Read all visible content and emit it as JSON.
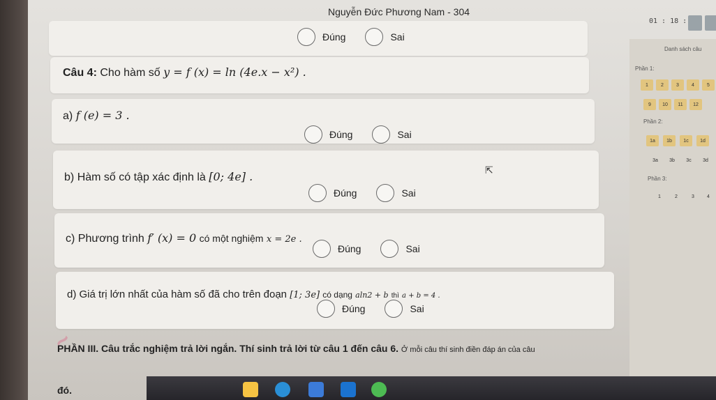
{
  "window": {
    "title": "Nguyễn Đức Phương Nam - 304",
    "timer": "01 : 18 : 26"
  },
  "options": {
    "true_label": "Đúng",
    "false_label": "Sai"
  },
  "question": {
    "label": "Câu 4:",
    "text": "Cho hàm số",
    "formula": "y = f (x) = ln (4e.x − x²) ."
  },
  "statements": [
    {
      "prefix": "a)",
      "text": "f (e) = 3 ."
    },
    {
      "prefix": "b)",
      "text": "Hàm số có tập xác định là",
      "formula": "[0; 4e] ."
    },
    {
      "prefix": "c)",
      "text": "Phương trình",
      "formula": "f′ (x) = 0",
      "text2": "có một nghiệm",
      "formula2": "x = 2e ."
    },
    {
      "prefix": "d)",
      "text": "Giá trị lớn nhất của hàm số đã cho trên đoạn",
      "formula": "[1; 3e]",
      "text2": "có dạng",
      "formula2": "aln2 + b",
      "text3": "thì",
      "formula3": "a + b = 4 ."
    }
  ],
  "part3": {
    "heading": "PHẦN III. Câu trắc nghiệm trả lời ngắn. Thí sinh trả lời từ câu 1 đến câu 6.",
    "rest": "Ở mỗi câu thí sinh điền đáp án của câu",
    "cont": "đó."
  },
  "sidebar": {
    "title": "Danh sách câu",
    "part1_label": "Phần 1:",
    "part1_row1": [
      "1",
      "2",
      "3",
      "4",
      "5"
    ],
    "part1_row2": [
      "9",
      "10",
      "11",
      "12"
    ],
    "part2_label": "Phần 2:",
    "part2_row1": [
      "1a",
      "1b",
      "1c",
      "1d"
    ],
    "part2_row2": [
      "3a",
      "3b",
      "3c",
      "3d"
    ],
    "part3_label": "Phần 3:",
    "part3_row1": [
      "1",
      "2",
      "3",
      "4"
    ]
  },
  "colors": {
    "answered": "#e2c57f",
    "card": "#f1efeb"
  }
}
